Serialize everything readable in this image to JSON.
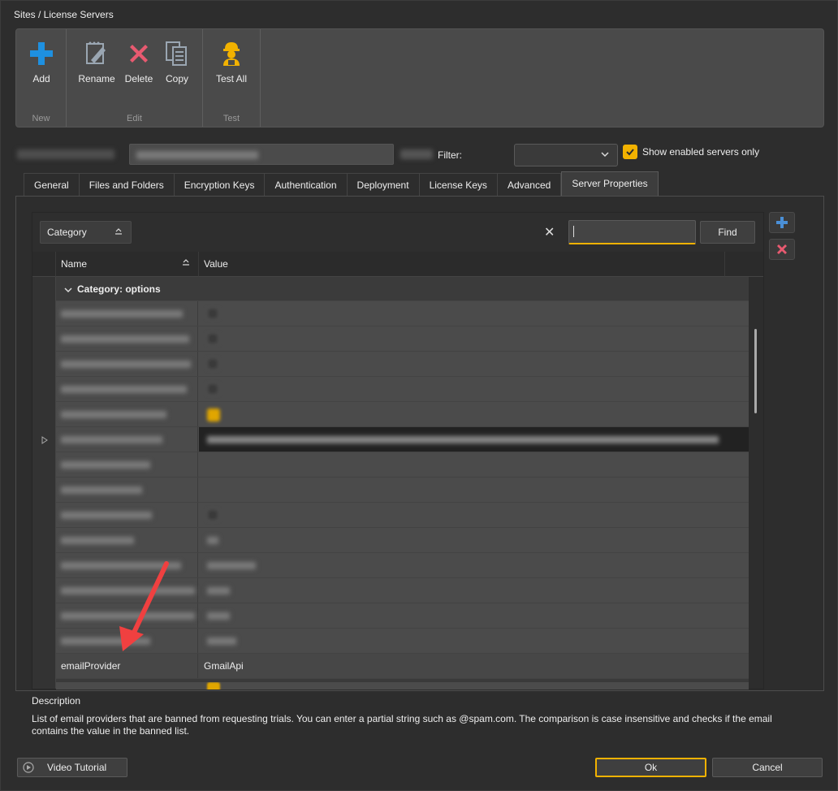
{
  "window": {
    "title": "Sites / License Servers"
  },
  "ribbon": {
    "groups": [
      {
        "label": "New",
        "buttons": [
          {
            "label": "Add",
            "icon": "plus-icon"
          }
        ]
      },
      {
        "label": "Edit",
        "buttons": [
          {
            "label": "Rename",
            "icon": "rename-icon"
          },
          {
            "label": "Delete",
            "icon": "delete-x-icon"
          },
          {
            "label": "Copy",
            "icon": "copy-icon"
          }
        ]
      },
      {
        "label": "Test",
        "buttons": [
          {
            "label": "Test All",
            "icon": "test-worker-icon"
          }
        ]
      }
    ]
  },
  "site_row": {
    "filter_label": "Filter:",
    "filter_value": "",
    "show_enabled_label": "Show enabled servers only",
    "show_enabled_checked": true
  },
  "tabs": [
    {
      "label": "General",
      "active": false
    },
    {
      "label": "Files and Folders",
      "active": false
    },
    {
      "label": "Encryption Keys",
      "active": false
    },
    {
      "label": "Authentication",
      "active": false
    },
    {
      "label": "Deployment",
      "active": false
    },
    {
      "label": "License Keys",
      "active": false
    },
    {
      "label": "Advanced",
      "active": false
    },
    {
      "label": "Server Properties",
      "active": true
    }
  ],
  "grid": {
    "group_by_label": "Category",
    "search_value": "",
    "find_label": "Find",
    "columns": {
      "name": "Name",
      "value": "Value"
    },
    "category_label": "Category: options",
    "visible_row": {
      "name": "emailProvider",
      "value": "GmailApi"
    }
  },
  "description": {
    "title": "Description",
    "text": "List of email providers that are banned from requesting trials. You can enter a partial string such as @spam.com. The comparison is case insensitive and checks if the email contains the value in the banned list."
  },
  "footer": {
    "video_label": "Video Tutorial",
    "ok_label": "Ok",
    "cancel_label": "Cancel"
  },
  "colors": {
    "accent": "#f2b200",
    "add_blue": "#1e90e0",
    "delete_red": "#e85a70",
    "annotation_arrow": "#f04040"
  }
}
